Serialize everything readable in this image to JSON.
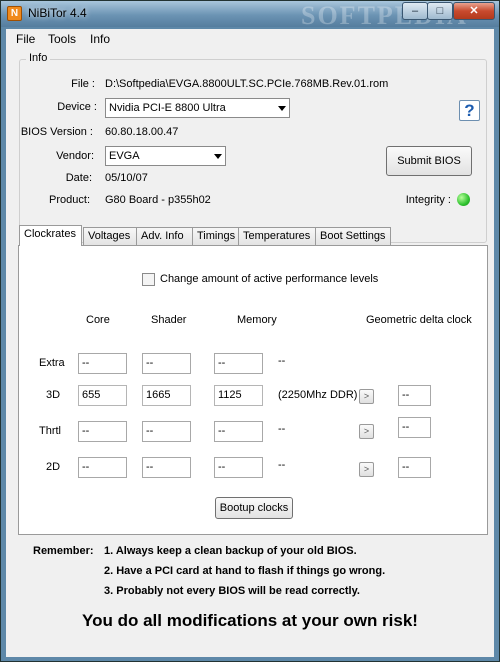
{
  "window": {
    "title": "NiBiTor 4.4",
    "watermark": "SOFTPEDIA"
  },
  "menu": [
    "File",
    "Tools",
    "Info"
  ],
  "info": {
    "group_label": "Info",
    "file_label": "File :",
    "file_value": "D:\\Softpedia\\EVGA.8800ULT.SC.PCIe.768MB.Rev.01.rom",
    "device_label": "Device :",
    "device_value": "Nvidia PCI-E 8800 Ultra",
    "bios_label": "BIOS Version :",
    "bios_value": "60.80.18.00.47",
    "vendor_label": "Vendor:",
    "vendor_value": "EVGA",
    "date_label": "Date:",
    "date_value": "05/10/07",
    "product_label": "Product:",
    "product_value": "G80 Board - p355h02",
    "submit_label": "Submit BIOS",
    "help_label": "?",
    "integrity_label": "Integrity :",
    "integrity_color": "#2fc22f"
  },
  "tabs": [
    "Clockrates",
    "Voltages",
    "Adv. Info",
    "Timings",
    "Temperatures",
    "Boot Settings"
  ],
  "clockrates": {
    "checkbox_label": "Change amount of active performance levels",
    "headers": {
      "core": "Core",
      "shader": "Shader",
      "memory": "Memory",
      "geometric": "Geometric delta clock"
    },
    "rows": [
      {
        "label": "Extra",
        "core": "--",
        "shader": "--",
        "memory": "--",
        "ddr": "--",
        "geo": ""
      },
      {
        "label": "3D",
        "core": "655",
        "shader": "1665",
        "memory": "1125",
        "ddr": "(2250Mhz DDR)",
        "geo": "--"
      },
      {
        "label": "Thrtl",
        "core": "--",
        "shader": "--",
        "memory": "--",
        "ddr": "--",
        "geo": "--"
      },
      {
        "label": "2D",
        "core": "--",
        "shader": "--",
        "memory": "--",
        "ddr": "--",
        "geo": "--"
      }
    ],
    "arrow_label": ">",
    "bootup_label": "Bootup clocks"
  },
  "remember": {
    "label": "Remember:",
    "items": [
      "1. Always keep a clean backup of your old BIOS.",
      "2. Have a PCI card at hand to flash if things go wrong.",
      "3. Probably not every BIOS will be read correctly."
    ],
    "risk": "You do all modifications at your own risk!"
  }
}
